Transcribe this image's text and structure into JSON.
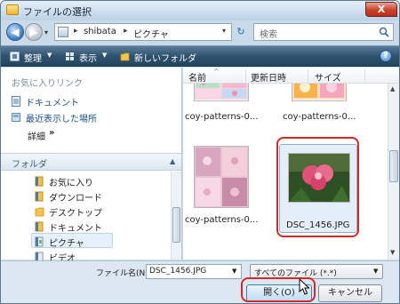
{
  "window": {
    "title": "ファイルの選択",
    "close_label": "X"
  },
  "address": {
    "back_glyph": "◀",
    "forward_glyph": "▶",
    "dropdown_glyph": "▾",
    "separator_glyph": "▸",
    "path_parts": [
      "shibata",
      "ピクチャ"
    ],
    "refresh_glyph": "↻",
    "search_placeholder": "検索"
  },
  "toolbar": {
    "organize_label": "整理",
    "view_label": "表示",
    "new_folder_label": "新しいフォルダ",
    "dropdown_glyph": "▼",
    "help_label": "?"
  },
  "favorites": {
    "heading": "お気に入りリンク",
    "items": [
      {
        "label": "ドキュメント",
        "icon": "document-icon"
      },
      {
        "label": "最近表示した場所",
        "icon": "recent-places-icon"
      }
    ],
    "details_label": "詳細",
    "details_glyph": "»"
  },
  "folders": {
    "heading": "フォルダ",
    "collapse_glyph": "▲",
    "items": [
      {
        "label": "お気に入り"
      },
      {
        "label": "ダウンロード"
      },
      {
        "label": "デスクトップ"
      },
      {
        "label": "ドキュメント"
      },
      {
        "label": "ピクチャ",
        "selected": true
      },
      {
        "label": "ビデオ"
      }
    ]
  },
  "columns": {
    "name": "名前",
    "modified": "更新日時",
    "size": "サイズ",
    "sort_glyph": "^"
  },
  "files": [
    {
      "name": "coy-patterns-0...",
      "thumb": "pink-floral-pattern"
    },
    {
      "name": "coy-patterns-0...",
      "thumb": "orange-flower-pattern"
    },
    {
      "name": "coy-patterns-0...",
      "thumb": "pink-pattern-collage"
    },
    {
      "name": "DSC_1456.JPG",
      "thumb": "pink-flower-photo",
      "selected": true
    }
  ],
  "footer": {
    "filename_label": "ファイル名(N):",
    "filename_value": "DSC_1456.JPG",
    "filetype_value": "すべてのファイル (*.*)",
    "dropdown_glyph": "▼",
    "open_label": "開く(O)",
    "cancel_label": "キャンセル"
  },
  "colors": {
    "highlight_ring": "#d22a2a",
    "toolbar_bg": "#2f526f",
    "link_text": "#1f4f86"
  }
}
